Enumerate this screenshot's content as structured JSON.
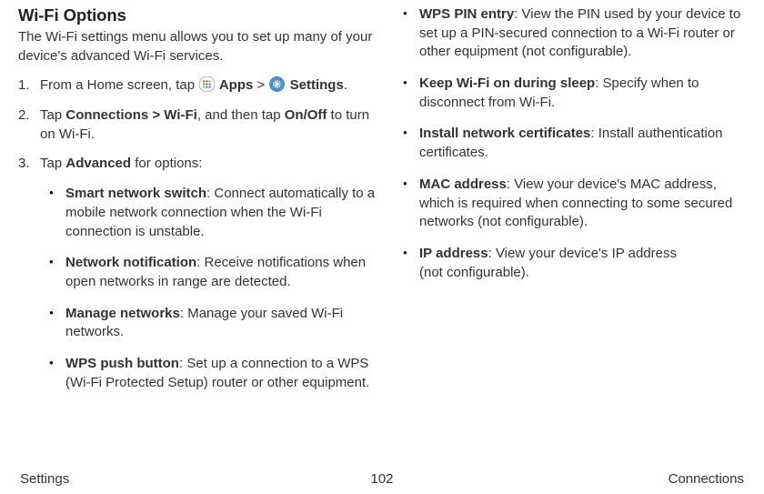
{
  "heading": "Wi-Fi Options",
  "intro": "The Wi-Fi settings menu allows you to set up many of your device's advanced Wi-Fi services.",
  "step1": {
    "prefix": "From a Home screen, tap ",
    "apps": " Apps",
    "sep": " > ",
    "settings": " Settings",
    "suffix": "."
  },
  "step2": {
    "t1": "Tap ",
    "b1": "Connections > Wi-Fi",
    "t2": ", and then tap ",
    "b2": "On/Off",
    "t3": " to turn on Wi-Fi."
  },
  "step3": {
    "t1": "Tap ",
    "b1": "Advanced",
    "t2": " for options:"
  },
  "left_bullets": [
    {
      "b": "Smart network switch",
      "t": ": Connect automatically to a mobile network connection when the Wi-Fi connection is unstable."
    },
    {
      "b": "Network notification",
      "t": ": Receive notifications when open networks in range are detected."
    },
    {
      "b": "Manage networks",
      "t": ": Manage your saved Wi-Fi networks."
    },
    {
      "b": "WPS push button",
      "t": ": Set up a connection to a WPS (Wi-Fi Protected Setup) router or other equipment."
    }
  ],
  "right_bullets": [
    {
      "b": "WPS PIN entry",
      "t": ": View the PIN used by your device to set up a PIN-secured connection to a Wi-Fi router or other equipment (not configurable)."
    },
    {
      "b": "Keep Wi-Fi on during sleep",
      "t": ": Specify when to disconnect from Wi-Fi."
    },
    {
      "b": "Install network certificates",
      "t": ": Install authentication certificates."
    },
    {
      "b": "MAC address",
      "t": ": View your device's MAC address, which is required when connecting to some secured networks (not configurable)."
    },
    {
      "b": "IP address",
      "t": ": View your device's IP address (not configurable)."
    }
  ],
  "footer": {
    "left": "Settings",
    "center": "102",
    "right": "Connections"
  }
}
